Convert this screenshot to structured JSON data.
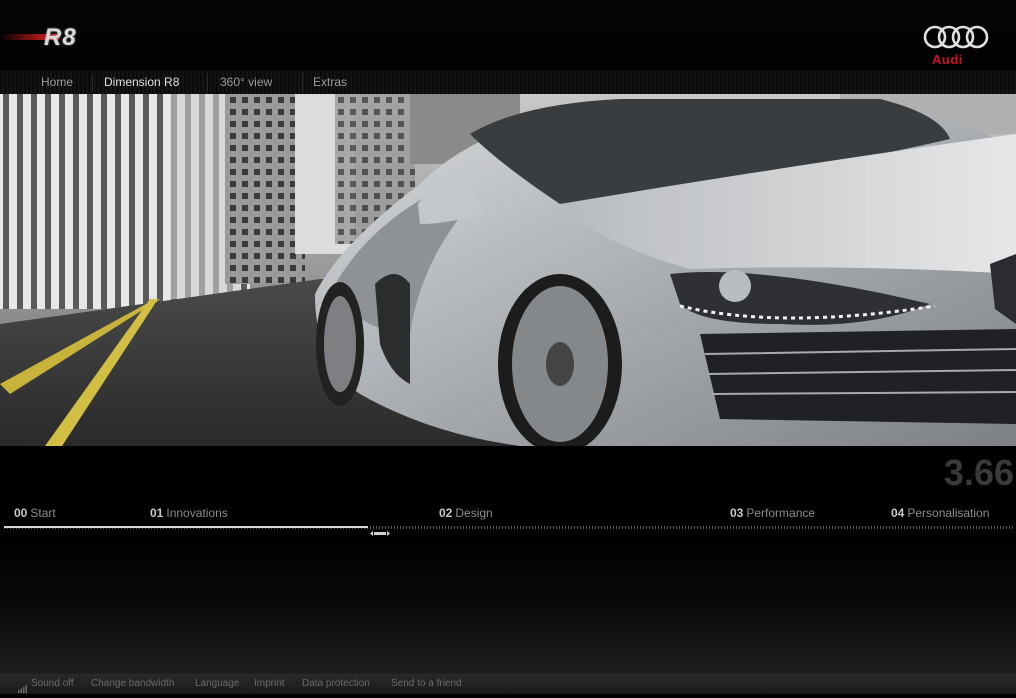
{
  "header": {
    "model_logo": "R8",
    "brand": "Audi"
  },
  "nav": {
    "items": [
      {
        "label": "Home",
        "active": false
      },
      {
        "label": "Dimension R8",
        "active": true
      },
      {
        "label": "360° view",
        "active": false
      },
      {
        "label": "Extras",
        "active": false
      }
    ]
  },
  "player": {
    "timecode": "3.66",
    "progress_fraction": 0.36,
    "chapters": [
      {
        "num": "00",
        "label": "Start"
      },
      {
        "num": "01",
        "label": "Innovations"
      },
      {
        "num": "02",
        "label": "Design"
      },
      {
        "num": "03",
        "label": "Performance"
      },
      {
        "num": "04",
        "label": "Personalisation"
      }
    ]
  },
  "footer": {
    "items": [
      "Sound off",
      "Change bandwidth",
      "Language",
      "Imprint",
      "Data protection",
      "Send to a friend"
    ]
  },
  "colors": {
    "brand_red": "#d01020",
    "background": "#000000"
  },
  "icons": {
    "sound": "sound-bars-icon",
    "handle": "scrubber-handle-icon"
  }
}
